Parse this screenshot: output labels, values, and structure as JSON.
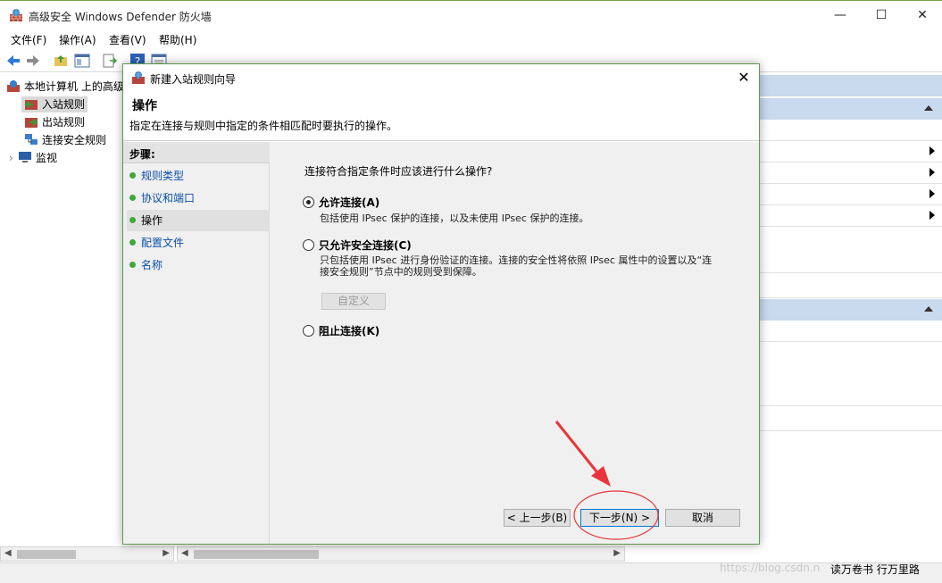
{
  "window": {
    "title": "高级安全 Windows Defender 防火墙",
    "minimize": "—",
    "maximize": "☐",
    "close": "✕"
  },
  "menu": [
    "文件(F)",
    "操作(A)",
    "查看(V)",
    "帮助(H)"
  ],
  "tree": {
    "root": "本地计算机 上的高级",
    "items": [
      "入站规则",
      "出站规则",
      "连接安全规则",
      "监视"
    ]
  },
  "dialog": {
    "title": "新建入站规则向导",
    "close": "✕",
    "heading": "操作",
    "subtitle": "指定在连接与规则中指定的条件相匹配时要执行的操作。",
    "steps_title": "步骤:",
    "steps": [
      "规则类型",
      "协议和端口",
      "操作",
      "配置文件",
      "名称"
    ],
    "current_step": "操作",
    "question": "连接符合指定条件时应该进行什么操作?",
    "options": [
      {
        "label": "允许连接(A)",
        "desc": "包括使用 IPsec 保护的连接，以及未使用 IPsec 保护的连接。",
        "selected": true
      },
      {
        "label": "只允许安全连接(C)",
        "desc": "只包括使用 IPsec 进行身份验证的连接。连接的安全性将依照 IPsec 属性中的设置以及“连接安全规则”节点中的规则受到保障。",
        "selected": false
      },
      {
        "label": "阻止连接(K)",
        "desc": "",
        "selected": false
      }
    ],
    "customize_button": "自定义",
    "back_button": "< 上一步(B)",
    "next_button": "下一步(N) >",
    "cancel_button": "取消"
  },
  "statusbar": {
    "watermark": "https://blog.csdn.n",
    "overlay_text": "读万卷书 行万里路"
  },
  "colors": {
    "annotation_red": "#e8353b",
    "link_blue": "#0b4fa8",
    "step_dot": "#3fa83a",
    "pane_header": "#c9d9ee"
  }
}
